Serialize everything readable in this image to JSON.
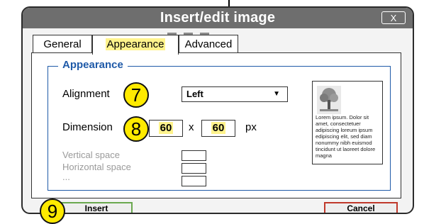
{
  "dialog": {
    "title": "Insert/edit image",
    "close_label": "X"
  },
  "tabs": [
    {
      "label": "General",
      "active": false
    },
    {
      "label": "Appearance",
      "active": true
    },
    {
      "label": "Advanced",
      "active": false
    }
  ],
  "appearance": {
    "legend": "Appearance",
    "alignment_label": "Alignment",
    "alignment_value": "Left",
    "dimensions_label": "Dimension",
    "width": "60",
    "separator": "x",
    "height": "60",
    "unit": "px",
    "vertical_space_label": "Vertical space",
    "horizontal_space_label": "Horizontal space",
    "more_label": "..."
  },
  "preview": {
    "text": "Lorem ipsum. Dolor sit amet, consectetuer adipiscing loreum ipsum edipiscing elit, sed diam nonummy nibh euismod tincidunt ut laoreet dolore magna"
  },
  "callouts": [
    "7",
    "8",
    "9"
  ],
  "buttons": {
    "insert": "Insert",
    "cancel": "Cancel"
  },
  "colors": {
    "titlebar": "#6e6e6e",
    "highlight": "#fff38c",
    "legend": "#1f5aa8",
    "callout": "#ffea00",
    "insert_border": "#6aa84f",
    "cancel_border": "#c0392b"
  }
}
